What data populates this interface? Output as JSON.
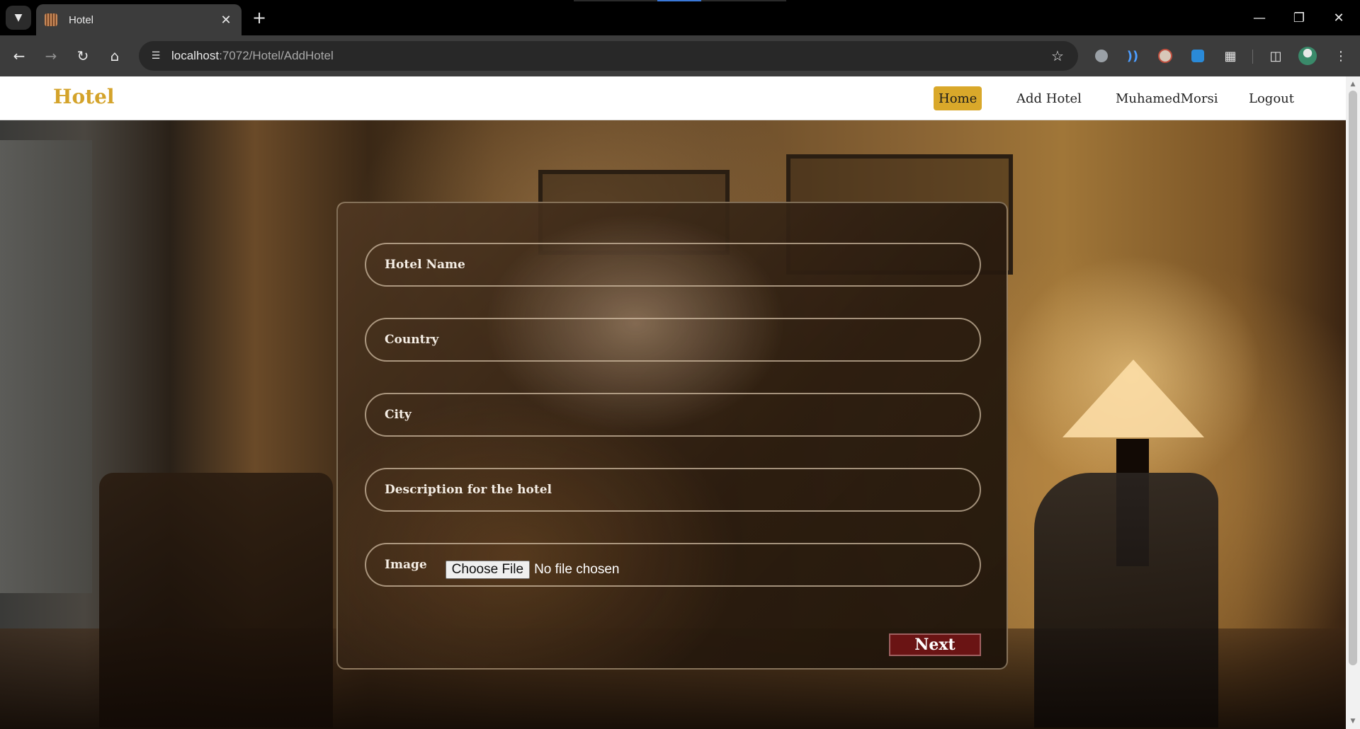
{
  "browser": {
    "tab_title": "Hotel",
    "url_host": "localhost",
    "url_rest": ":7072/Hotel/AddHotel",
    "icons": {
      "tab_search": "chevron-down-icon",
      "close_tab": "close-icon",
      "new_tab": "plus-icon",
      "back": "arrow-left-icon",
      "forward": "arrow-right-icon",
      "reload": "reload-icon",
      "home": "home-icon",
      "site_info": "tune-icon",
      "bookmark": "star-icon",
      "minimize": "minimize-icon",
      "restore": "restore-icon",
      "close_window": "close-icon"
    }
  },
  "navbar": {
    "brand": "Hotel",
    "links": [
      {
        "label": "Home",
        "active": true
      },
      {
        "label": "Add Hotel",
        "active": false
      },
      {
        "label": "MuhamedMorsi",
        "active": false
      },
      {
        "label": "Logout",
        "active": false
      }
    ],
    "brand_color": "#d4a32a",
    "active_color": "#d9a82a"
  },
  "form": {
    "fields": [
      {
        "label": "Hotel Name"
      },
      {
        "label": "Country"
      },
      {
        "label": "City"
      },
      {
        "label": "Description for the hotel"
      }
    ],
    "image": {
      "label": "Image",
      "button": "Choose File",
      "status": "No file chosen"
    },
    "submit_label": "Next",
    "submit_color": "#6a1414"
  }
}
